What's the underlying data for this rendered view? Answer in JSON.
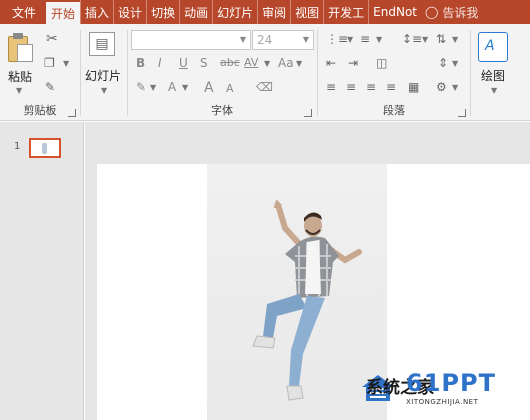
{
  "tabs": [
    "文件",
    "开始",
    "插入",
    "设计",
    "切换",
    "动画",
    "幻灯片",
    "审阅",
    "视图",
    "开发工",
    "EndNot",
    "告诉我"
  ],
  "active_tab": "开始",
  "ribbon": {
    "clipboard": {
      "paste_label": "粘贴",
      "group_label": "剪贴板"
    },
    "slides": {
      "slides_label": "幻灯片"
    },
    "font": {
      "font_name_value": "",
      "font_size_value": "24",
      "bold": "B",
      "italic": "I",
      "underline": "U",
      "shadow": "S",
      "strike": "abc",
      "spacing": "AV",
      "case": "Aa",
      "grow": "A",
      "shrink": "A",
      "group_label": "字体"
    },
    "paragraph": {
      "group_label": "段落"
    },
    "drawing": {
      "draw_label": "绘图",
      "draw_glyph": "A"
    }
  },
  "thumbnail": {
    "number": "1"
  },
  "watermark": {
    "brand": "61PPT",
    "text": "系统之家",
    "url": "XITONGZHIJIA.NET"
  },
  "colors": {
    "accent": "#b7472a",
    "selection": "#d6532c",
    "brand_blue": "#2f73c9"
  }
}
